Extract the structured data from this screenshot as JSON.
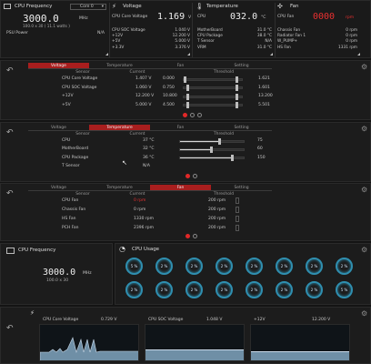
{
  "top": {
    "freq": {
      "title": "CPU Frequency",
      "core_select": "Core 0",
      "value": "3000.0",
      "unit": "MHz",
      "sub": "100.0 x 30  ( 11.1 watts )",
      "psu_label": "PSU Power",
      "psu_value": "N/A"
    },
    "voltage": {
      "title": "Voltage",
      "label": "CPU Core Voltage",
      "value": "1.169",
      "unit": "V",
      "rows": [
        {
          "k": "CPU SOC Voltage",
          "v": "1.040 V"
        },
        {
          "k": "+12V",
          "v": "12.200 V"
        },
        {
          "k": "+5V",
          "v": "5.000 V"
        },
        {
          "k": "+3.3V",
          "v": "3.376 V"
        }
      ]
    },
    "temperature": {
      "title": "Temperature",
      "label": "CPU",
      "value": "032.0",
      "unit": "°C",
      "rows": [
        {
          "k": "MotherBoard",
          "v": "31.0 °C"
        },
        {
          "k": "CPU Package",
          "v": "38.0 °C"
        },
        {
          "k": "T Sensor",
          "v": "N/A"
        },
        {
          "k": "VRM",
          "v": "31.0 °C"
        }
      ]
    },
    "fan": {
      "title": "Fan",
      "label": "CPU Fan",
      "value": "0000",
      "unit": "rpm",
      "rows": [
        {
          "k": "Chassis Fan",
          "v": "0 rpm"
        },
        {
          "k": "Radiator Fan 1",
          "v": "0 rpm"
        },
        {
          "k": "W_PUMP+",
          "v": "0 rpm"
        },
        {
          "k": "HS Fan",
          "v": "1331 rpm"
        }
      ]
    }
  },
  "tabs": [
    "Voltage",
    "Temperature",
    "Fan",
    "Setting"
  ],
  "cols": {
    "sensor": "Sensor",
    "current": "Current",
    "threshold": "Threshold"
  },
  "voltage_panel": [
    {
      "name": "CPU Core Voltage",
      "current": "1.407 V",
      "low": "0.000",
      "high": "1.621",
      "lowfrac": 0.0,
      "highfrac": 0.92
    },
    {
      "name": "CPU SOC Voltage",
      "current": "1.060 V",
      "low": "0.750",
      "high": "1.601",
      "lowfrac": 0.05,
      "highfrac": 0.92
    },
    {
      "name": "+12V",
      "current": "12.200 V",
      "low": "10.800",
      "high": "13.200",
      "lowfrac": 0.05,
      "highfrac": 0.92
    },
    {
      "name": "+5V",
      "current": "5.000 V",
      "low": "4.500",
      "high": "5.501",
      "lowfrac": 0.05,
      "highfrac": 0.92
    }
  ],
  "temp_panel": [
    {
      "name": "CPU",
      "current": "37 °C",
      "thr": "75",
      "frac": 0.62
    },
    {
      "name": "MotherBoard",
      "current": "32 °C",
      "thr": "60",
      "frac": 0.48
    },
    {
      "name": "CPU Package",
      "current": "36 °C",
      "thr": "150",
      "frac": 0.83
    },
    {
      "name": "T Sensor",
      "current": "N/A",
      "thr": "",
      "frac": null
    }
  ],
  "fan_panel": [
    {
      "name": "CPU Fan",
      "current": "0 rpm",
      "thr": "200 rpm"
    },
    {
      "name": "Chassis Fan",
      "current": "0 rpm",
      "thr": "200 rpm"
    },
    {
      "name": "HS Fan",
      "current": "1330 rpm",
      "thr": "200 rpm"
    },
    {
      "name": "PCH Fan",
      "current": "2396 rpm",
      "thr": "200 rpm"
    }
  ],
  "freq_panel": {
    "title": "CPU Frequency",
    "value": "3000.0",
    "unit": "MHz",
    "sub": "100.0 x 30"
  },
  "usage_panel": {
    "title": "CPU Usage",
    "cores": [
      "5 %",
      "2 %",
      "2 %",
      "2 %",
      "2 %",
      "2 %",
      "2 %",
      "2 %",
      "2 %",
      "2 %",
      "2 %",
      "2 %",
      "2 %",
      "2 %",
      "2 %",
      "5 %"
    ]
  },
  "graphs": [
    {
      "label": "CPU Core Voltage",
      "value": "0.729 V"
    },
    {
      "label": "CPU SOC Voltage",
      "value": "1.048 V"
    },
    {
      "label": "+12V",
      "value": "12.200 V"
    }
  ]
}
